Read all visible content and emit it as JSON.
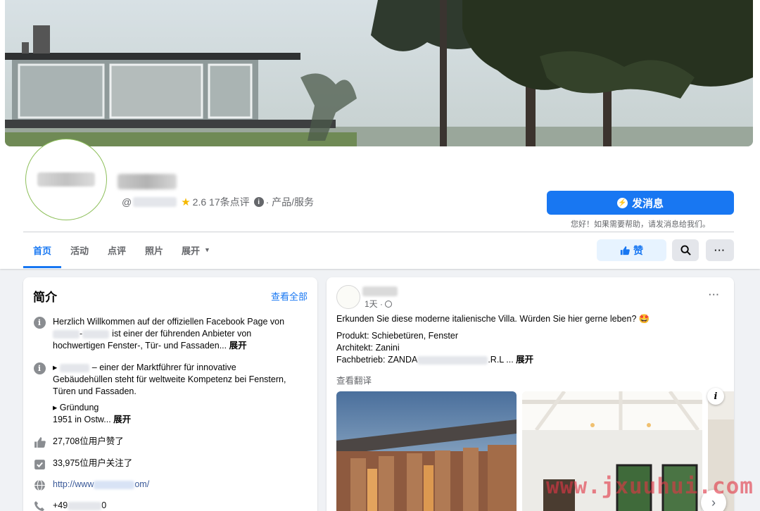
{
  "header": {
    "meta": {
      "at": "@",
      "rating": "2.6",
      "reviews": "17条点评",
      "category_sep": "·",
      "category": "产品/服务"
    },
    "message_button": "发消息",
    "message_hint": "您好！如果需要帮助，请发消息给我们。",
    "tabs": [
      "首页",
      "活动",
      "点评",
      "照片",
      "展开"
    ],
    "active_tab": "首页",
    "like_label": "赞",
    "more_label": "···"
  },
  "intro": {
    "title": "简介",
    "see_all": "查看全部",
    "row1": {
      "line1": "Herzlich Willkommen auf der offiziellen Facebook Page von",
      "line2_rest": "ist einer der führenden Anbieter von",
      "line3": "hochwertigen Fenster-, Tür- und Fassaden...",
      "expand": "展开"
    },
    "row2": {
      "line1_prefix": "▸",
      "line1_rest": "– einer der Marktführer für innovative",
      "line2": "Gebäudehüllen steht für weltweite Kompetenz bei Fenstern,",
      "line3": "Türen und Fassaden.",
      "line4": "▸ Gründung",
      "line5": "1951 in Ostw...",
      "expand": "展开"
    },
    "likes": "27,708位用户赞了",
    "follows": "33,975位用户关注了",
    "website_prefix": "http://www",
    "website_suffix": "om/",
    "phone_prefix": "+49",
    "phone_suffix": "0"
  },
  "post": {
    "time": "1天 ·",
    "more": "···",
    "text1": "Erkunden Sie diese moderne italienische Villa. Würden Sie hier gerne leben? 🤩",
    "text2": "Produkt: Schiebetüren, Fenster",
    "text3": "Architekt: Zanini",
    "text4_prefix": "Fachbetrieb: ZANDA",
    "text4_suffix": ".R.L ...",
    "expand": "展开",
    "translate": "查看翻译",
    "photo_info": "i",
    "next": "›"
  },
  "watermark": "www.jxuuhui.com",
  "colors": {
    "accent": "#1877f2",
    "background": "#f0f2f5",
    "star": "#f5b800"
  },
  "icons": [
    "messenger-icon",
    "star-icon",
    "info-icon",
    "thumbs-up-icon",
    "search-icon",
    "more-icon",
    "follow-icon",
    "globe-icon",
    "phone-icon",
    "chevron-down-icon",
    "chevron-right-icon"
  ]
}
